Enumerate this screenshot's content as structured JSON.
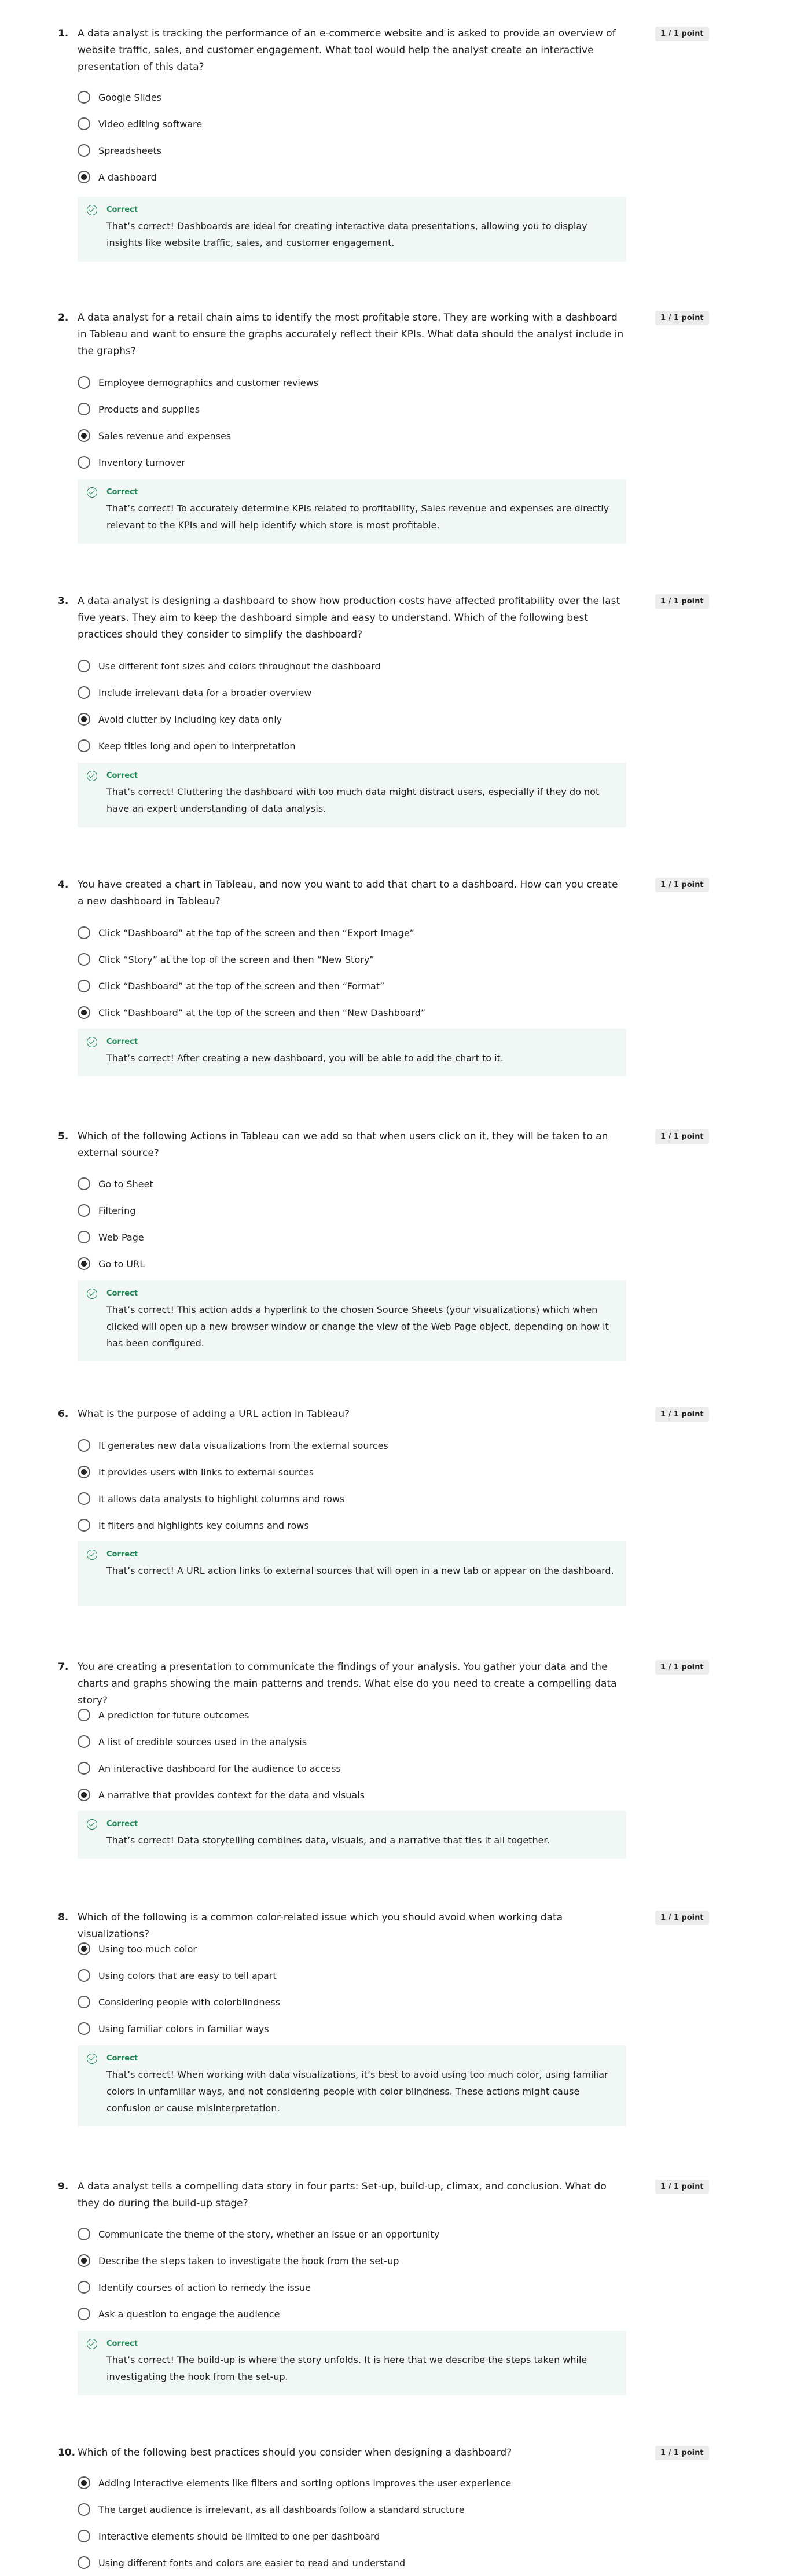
{
  "quiz": {
    "questions": [
      {
        "number": "1.",
        "text": "A data analyst is tracking the performance of an e-commerce website and is asked to provide an overview of website traffic, sales, and customer engagement. What tool would help the analyst create an interactive presentation of this data?",
        "points": "1 / 1 point",
        "options": [
          {
            "label": "Google Slides",
            "selected": false
          },
          {
            "label": "Video editing software",
            "selected": false
          },
          {
            "label": "Spreadsheets",
            "selected": false
          },
          {
            "label": "A dashboard",
            "selected": true
          }
        ],
        "feedback": {
          "status": "Correct",
          "text": "That’s correct! Dashboards are ideal for creating interactive data presentations, allowing you to display insights like website traffic, sales, and customer engagement."
        }
      },
      {
        "number": "2.",
        "text": "A data analyst for a retail chain aims to identify the most profitable store. They are working with a dashboard in Tableau and want to ensure the graphs accurately reflect their KPIs. What data should the analyst include in the graphs?",
        "points": "1 / 1 point",
        "options": [
          {
            "label": "Employee demographics and customer reviews",
            "selected": false
          },
          {
            "label": "Products and supplies",
            "selected": false
          },
          {
            "label": "Sales revenue and expenses",
            "selected": true
          },
          {
            "label": "Inventory turnover",
            "selected": false
          }
        ],
        "feedback": {
          "status": "Correct",
          "text": "That’s correct! To accurately determine KPIs related to profitability, Sales revenue and expenses are directly relevant to the KPIs and will help identify which store is most profitable."
        }
      },
      {
        "number": "3.",
        "text": "A data analyst is designing a dashboard to show how production costs have affected profitability over the last five years. They aim to keep the dashboard simple and easy to understand. Which of the following best practices should they consider to simplify the dashboard?",
        "points": "1 / 1 point",
        "options": [
          {
            "label": "Use different font sizes and colors throughout the dashboard",
            "selected": false
          },
          {
            "label": "Include irrelevant data for a broader overview",
            "selected": false
          },
          {
            "label": "Avoid clutter by including key data only",
            "selected": true
          },
          {
            "label": "Keep titles long and open to interpretation",
            "selected": false
          }
        ],
        "feedback": {
          "status": "Correct",
          "text": "That’s correct! Cluttering the dashboard with too much data might distract users, especially if they do not have an expert understanding of data analysis."
        }
      },
      {
        "number": "4.",
        "text": "You have created a chart in Tableau, and now you want to add that chart to a dashboard. How can you create a new dashboard in Tableau?",
        "points": "1 / 1 point",
        "options": [
          {
            "label": "Click “Dashboard” at the top of the screen and then “Export Image”",
            "selected": false
          },
          {
            "label": "Click “Story” at the top of the screen and then “New Story”",
            "selected": false
          },
          {
            "label": "Click “Dashboard” at the top of the screen and then “Format”",
            "selected": false
          },
          {
            "label": "Click “Dashboard” at the top of the screen and then “New Dashboard”",
            "selected": true
          }
        ],
        "feedback": {
          "status": "Correct",
          "text": "That’s correct! After creating a new dashboard, you will be able to add the chart to it."
        }
      },
      {
        "number": "5.",
        "text": "Which of the following Actions in Tableau can we add so that when users click on it, they will be taken to an external source?",
        "points": "1 / 1 point",
        "options": [
          {
            "label": "Go to Sheet",
            "selected": false
          },
          {
            "label": "Filtering",
            "selected": false
          },
          {
            "label": "Web Page",
            "selected": false
          },
          {
            "label": "Go to URL",
            "selected": true
          }
        ],
        "feedback": {
          "status": "Correct",
          "text": "That’s correct! This action adds a hyperlink to the chosen Source Sheets (your visualizations) which when clicked will open up a new browser window or change the view of the Web Page object, depending on how it has been configured."
        }
      },
      {
        "number": "6.",
        "text": "What is the purpose of adding a URL action in Tableau?",
        "points": "1 / 1 point",
        "options": [
          {
            "label": "It generates new data visualizations from the external sources",
            "selected": false
          },
          {
            "label": "It provides users with links to external sources",
            "selected": true
          },
          {
            "label": "It allows data analysts to highlight columns and rows",
            "selected": false
          },
          {
            "label": "It filters and highlights key columns and rows",
            "selected": false
          }
        ],
        "feedback": {
          "status": "Correct",
          "text": "That’s correct! A URL action links to external sources that will open in a new tab or appear on the dashboard."
        }
      },
      {
        "number": "7.",
        "text": "You are creating a presentation to communicate the findings of your analysis. You gather your data and the charts and graphs showing the main patterns and trends. What else do you need to create a compelling data story?",
        "points": "1 / 1 point",
        "options": [
          {
            "label": "A prediction for future outcomes",
            "selected": false
          },
          {
            "label": "A list of credible sources used in the analysis",
            "selected": false
          },
          {
            "label": "An interactive dashboard for the audience to access",
            "selected": false
          },
          {
            "label": "A narrative that provides context for the data and visuals",
            "selected": true
          }
        ],
        "feedback": {
          "status": "Correct",
          "text": "That’s correct! Data storytelling combines data, visuals, and a narrative that ties it all together."
        }
      },
      {
        "number": "8.",
        "text": "Which of the following is a common color-related issue which you should avoid when working data visualizations?",
        "points": "1 / 1 point",
        "options": [
          {
            "label": "Using too much color",
            "selected": true
          },
          {
            "label": "Using colors that are easy to tell apart",
            "selected": false
          },
          {
            "label": "Considering people with colorblindness",
            "selected": false
          },
          {
            "label": "Using familiar colors in familiar ways",
            "selected": false
          }
        ],
        "feedback": {
          "status": "Correct",
          "text": "That’s correct! When working with data visualizations, it’s best to avoid using too much color, using familiar colors in unfamiliar ways, and not considering people with color blindness. These actions might cause confusion or cause misinterpretation."
        }
      },
      {
        "number": "9.",
        "text": "A data analyst tells a compelling data story in four parts: Set-up, build-up, climax, and conclusion. What do they do during the build-up stage?",
        "points": "1 / 1 point",
        "options": [
          {
            "label": "Communicate the theme of the story, whether an issue or an opportunity",
            "selected": false
          },
          {
            "label": "Describe the steps taken to investigate the hook from the set-up",
            "selected": true
          },
          {
            "label": "Identify courses of action to remedy the issue",
            "selected": false
          },
          {
            "label": "Ask a question to engage the audience",
            "selected": false
          }
        ],
        "feedback": {
          "status": "Correct",
          "text": "That’s correct! The build-up is where the story unfolds. It is here that we describe the steps taken while investigating the hook from the set-up."
        }
      },
      {
        "number": "10.",
        "text": "Which of the following best practices should you consider when designing a dashboard?",
        "points": "1 / 1 point",
        "options": [
          {
            "label": "Adding interactive elements like filters and sorting options improves the user experience",
            "selected": true
          },
          {
            "label": "The target audience is irrelevant, as all dashboards follow a standard structure",
            "selected": false
          },
          {
            "label": "Interactive elements should be limited to one per dashboard",
            "selected": false
          },
          {
            "label": "Using different fonts and colors are easier to read and understand",
            "selected": false
          }
        ]
      }
    ]
  },
  "colors": {
    "correct": "#1f8354",
    "feedback_bg": "#f1f7f4",
    "points_bg": "#ececec"
  },
  "icons": {
    "feedback": "check-circle-icon",
    "option": "radio-icon"
  }
}
